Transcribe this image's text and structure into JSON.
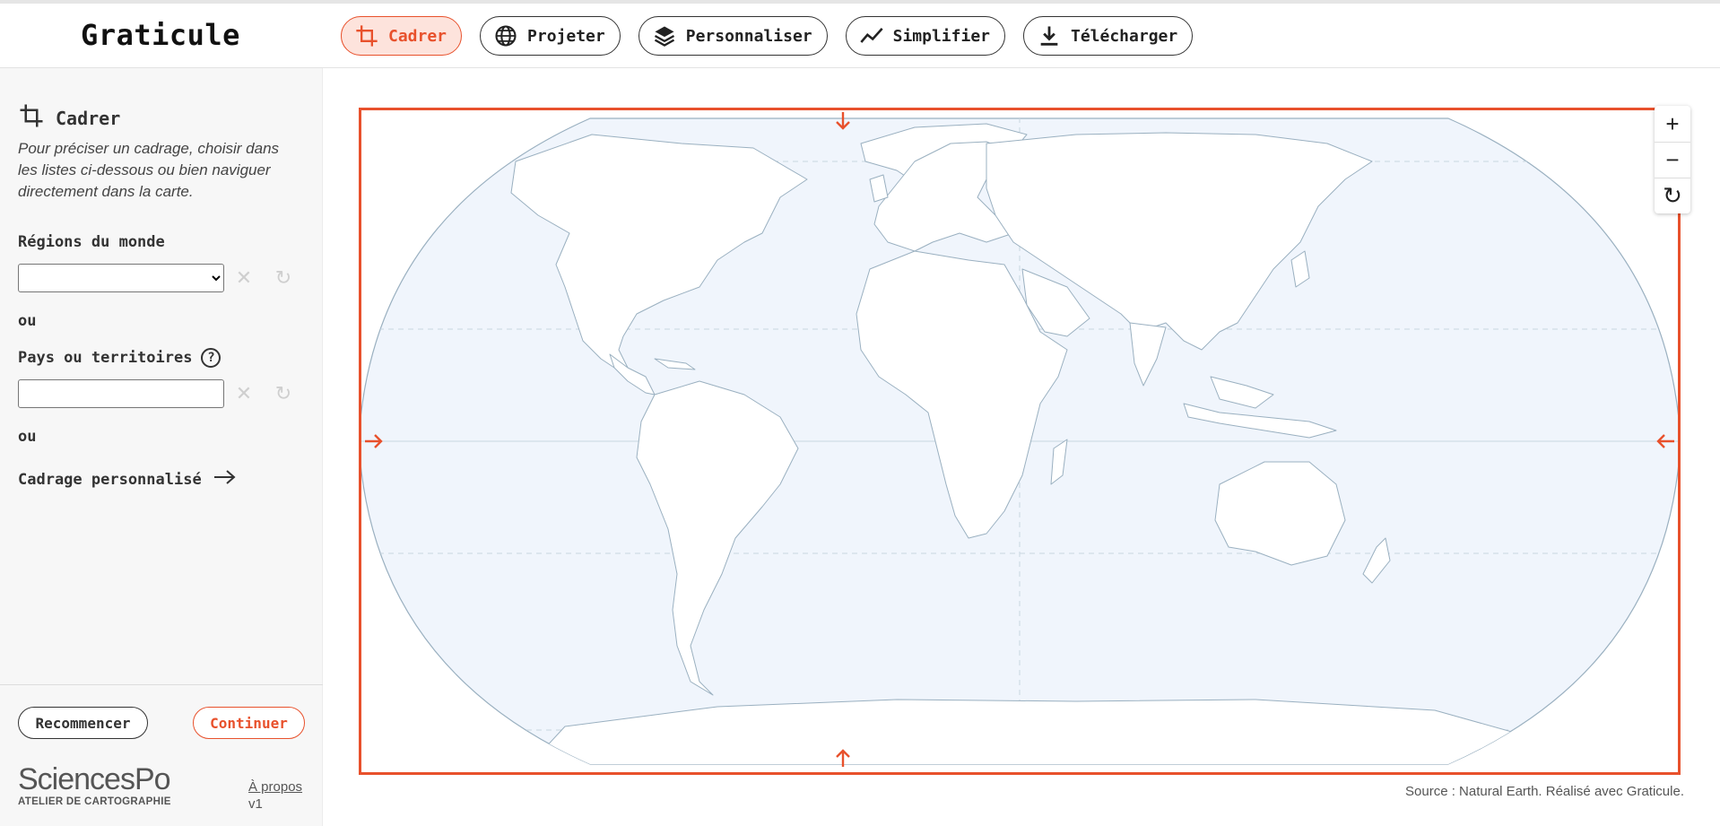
{
  "app": {
    "title": "Graticule"
  },
  "nav": [
    {
      "label": "Cadrer",
      "icon": "crop-icon",
      "active": true
    },
    {
      "label": "Projeter",
      "icon": "globe-icon",
      "active": false
    },
    {
      "label": "Personnaliser",
      "icon": "layers-icon",
      "active": false
    },
    {
      "label": "Simplifier",
      "icon": "trend-line-icon",
      "active": false
    },
    {
      "label": "Télécharger",
      "icon": "download-icon",
      "active": false
    }
  ],
  "sidebar": {
    "title": "Cadrer",
    "description": "Pour préciser un cadrage, choisir dans les listes ci-dessous ou bien naviguer directement dans la carte.",
    "regions_label": "Régions du monde",
    "regions_value": "",
    "or1": "ou",
    "countries_label": "Pays ou territoires",
    "countries_value": "",
    "or2": "ou",
    "custom_label": "Cadrage personnalisé",
    "restart_label": "Recommencer",
    "continue_label": "Continuer",
    "logo_main": "SciencesPo",
    "logo_sub": "ATELIER DE CARTOGRAPHIE",
    "about_label": "À propos",
    "version": "v1"
  },
  "map": {
    "source": "Source : Natural Earth. Réalisé avec Graticule.",
    "accent_color": "#e8512c",
    "ocean_color": "#f0f5fc",
    "land_color": "#ffffff",
    "outline_color": "#9ab0c0"
  }
}
